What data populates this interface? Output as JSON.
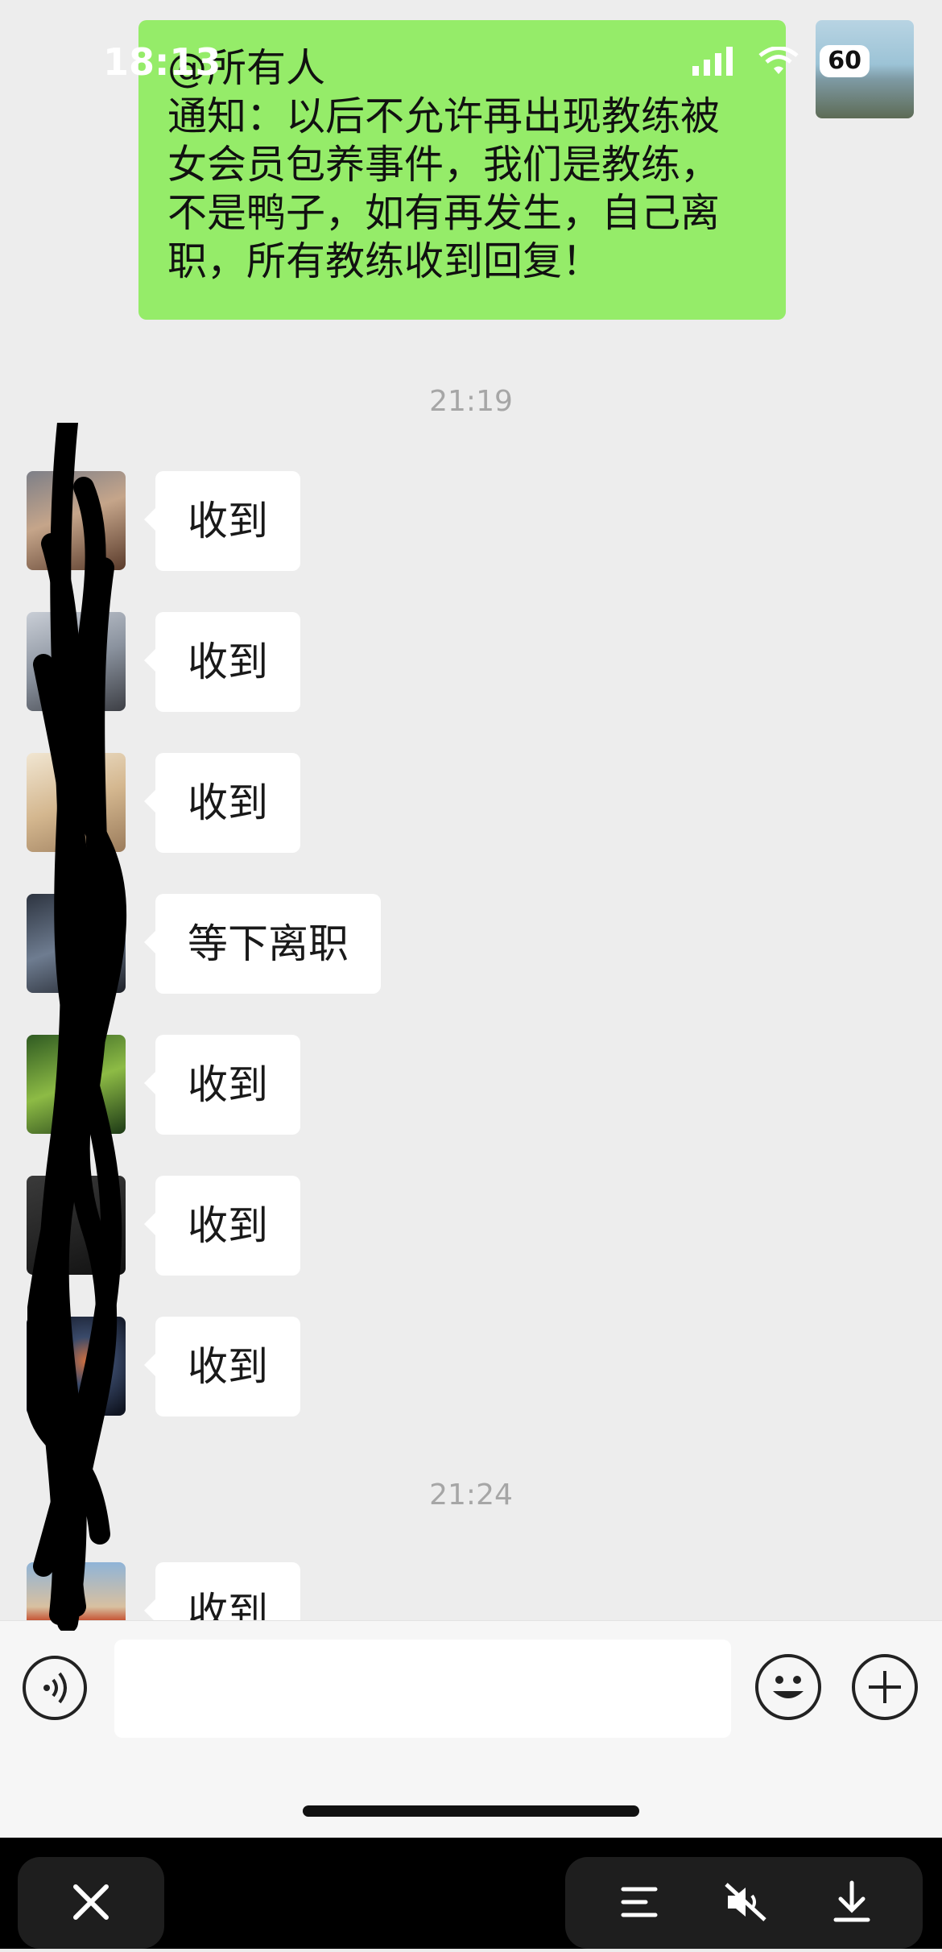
{
  "status_bar": {
    "time": "18:13",
    "battery": "60"
  },
  "sent_message": {
    "lines": [
      "@所有人",
      "通知：以后不允许再出现教练被",
      "女会员包养事件，我们是教练，",
      "不是鸭子，如有再发生，自己离",
      "职，所有教练收到回复！"
    ]
  },
  "timestamps": [
    "21:19",
    "21:24"
  ],
  "received_messages": [
    {
      "text": "收到"
    },
    {
      "text": "收到"
    },
    {
      "text": "收到"
    },
    {
      "text": "等下离职"
    },
    {
      "text": "收到"
    },
    {
      "text": "收到"
    },
    {
      "text": "收到"
    },
    {
      "text": "收到"
    }
  ],
  "input_bar": {
    "placeholder": ""
  },
  "icons": {
    "voice": "voice-icon",
    "emoji": "emoji-icon",
    "plus": "plus-icon",
    "close": "close-icon",
    "menu": "menu-icon",
    "mute": "mute-icon",
    "download": "download-icon"
  },
  "colors": {
    "sent_bubble": "#95ec69",
    "background": "#ededed",
    "received_bubble": "#ffffff"
  }
}
